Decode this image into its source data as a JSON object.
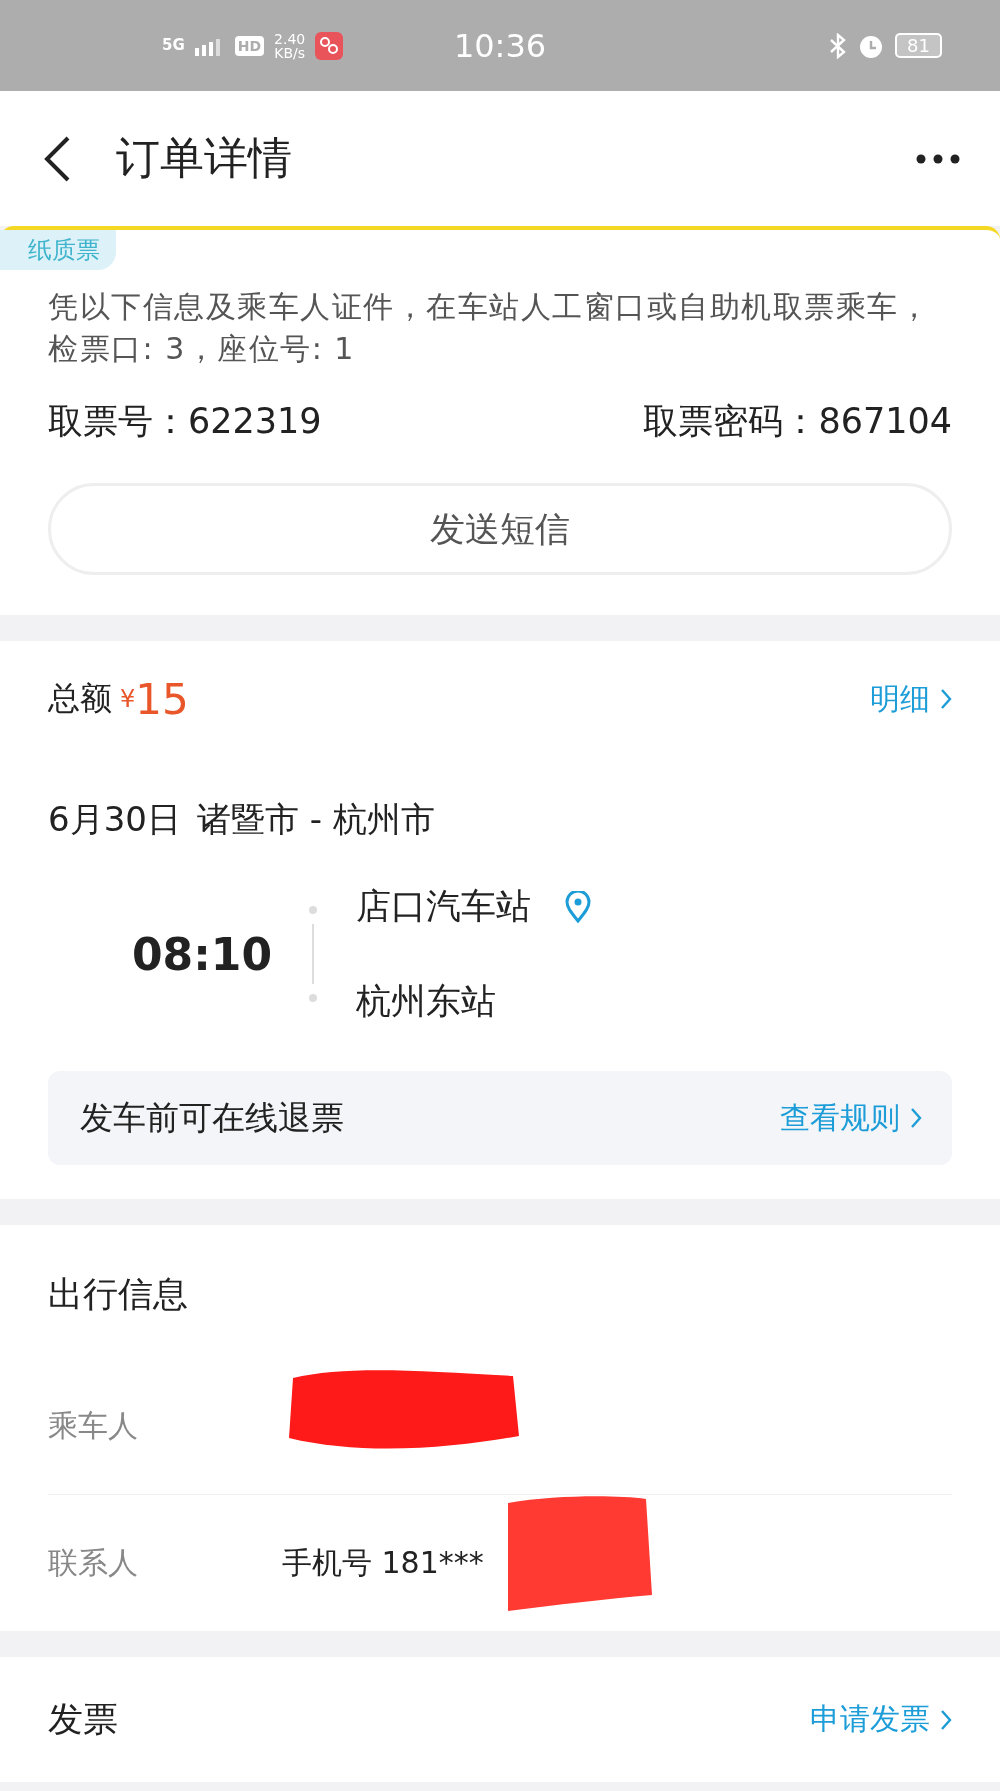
{
  "status_bar": {
    "network": "5G",
    "hd": "HD",
    "speed": "2.40",
    "speed_unit": "KB/s",
    "time": "10:36",
    "battery": "81"
  },
  "header": {
    "title": "订单详情"
  },
  "ticket": {
    "tag": "纸质票",
    "instruction": "凭以下信息及乘车人证件，在车站人工窗口或自助机取票乘车，检票口: 3，座位号: 1",
    "pickup_label": "取票号：",
    "pickup_number": "622319",
    "password_label": "取票密码：",
    "password": "867104",
    "sms_button": "发送短信"
  },
  "order": {
    "total_label": "总额",
    "currency": "¥",
    "total": "15",
    "detail_link": "明细",
    "date": "6月30日",
    "route": "诸暨市 - 杭州市",
    "depart_time": "08:10",
    "from_station": "店口汽车站",
    "to_station": "杭州东站",
    "refund_note": "发车前可在线退票",
    "rules_link": "查看规则"
  },
  "travel": {
    "title": "出行信息",
    "rows": [
      {
        "label": "乘车人",
        "value": ""
      },
      {
        "label": "联系人",
        "value": "手机号 181***"
      }
    ]
  },
  "invoice": {
    "title": "发票",
    "link": "申请发票"
  }
}
